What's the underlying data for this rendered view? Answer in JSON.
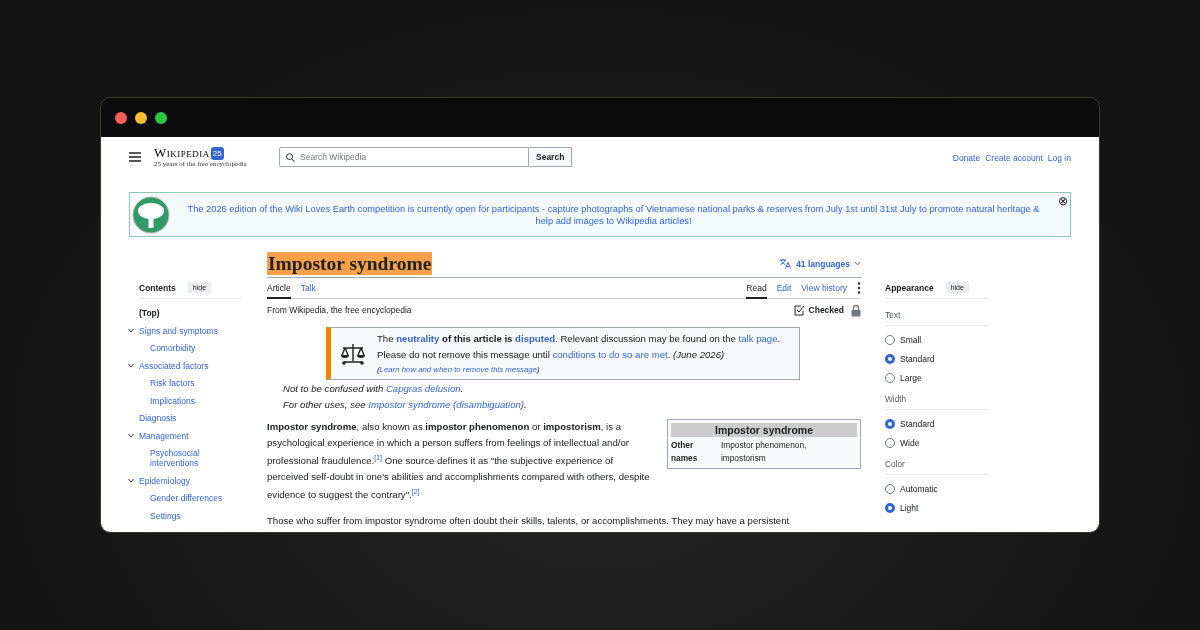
{
  "header": {
    "logo_title": "Wikipedia",
    "logo_badge": "25",
    "logo_tagline": "25 years of the free encyclopedia",
    "search": {
      "placeholder": "Search Wikipedia",
      "button": "Search"
    },
    "links": [
      "Donate",
      "Create account",
      "Log in"
    ]
  },
  "banner": {
    "text": "The 2026 edition of the Wiki Loves Earth competition is currently open for participants - capture photographs of Vietnamese national parks & reserves from July 1st until 31st July to promote natural heritage & help add images to Wikipedia articles!",
    "close": "⊗"
  },
  "toc": {
    "title": "Contents",
    "hide": "hide",
    "items": [
      {
        "label": "(Top)",
        "selected": true
      },
      {
        "label": "Signs and symptoms",
        "selected": false,
        "expanded": true,
        "children": [
          {
            "label": "Comorbidity",
            "selected": false
          }
        ]
      },
      {
        "label": "Associated factors",
        "selected": false,
        "expanded": true,
        "children": [
          {
            "label": "Risk factors",
            "selected": false
          },
          {
            "label": "Implications",
            "selected": false
          }
        ]
      },
      {
        "label": "Diagnosis",
        "selected": false
      },
      {
        "label": "Management",
        "selected": false,
        "expanded": true,
        "children": [
          {
            "label": "Psychosocial interventions",
            "selected": false
          }
        ]
      },
      {
        "label": "Epidemiology",
        "selected": false,
        "expanded": true,
        "children": [
          {
            "label": "Gender differences",
            "selected": false
          },
          {
            "label": "Settings",
            "selected": false
          }
        ]
      }
    ]
  },
  "article": {
    "title": "Impostor syndrome",
    "languages": "41 languages",
    "tabs_left": [
      {
        "label": "Article",
        "selected": true
      },
      {
        "label": "Talk",
        "selected": false
      }
    ],
    "tabs_right": [
      {
        "label": "Read",
        "selected": true
      },
      {
        "label": "Edit",
        "selected": false
      },
      {
        "label": "View history",
        "selected": false
      }
    ],
    "tagline": "From Wikipedia, the free encyclopedia",
    "checked": "Checked",
    "notice": {
      "lines": [
        [
          {
            "kind": "plain",
            "text": "The "
          },
          {
            "kind": "boldlink",
            "text": "neutrality"
          },
          {
            "kind": "bold",
            "text": " of this article is "
          },
          {
            "kind": "boldlink",
            "text": "disputed"
          },
          {
            "kind": "plain",
            "text": ". Relevant discussion may be found on the "
          },
          {
            "kind": "link",
            "text": "talk page"
          },
          {
            "kind": "plain",
            "text": ". Please do not remove this message until "
          },
          {
            "kind": "link",
            "text": "conditions to do so are met"
          },
          {
            "kind": "plain",
            "text": ". "
          },
          {
            "kind": "italic",
            "text": "(June 2026)"
          }
        ],
        [
          {
            "kind": "small",
            "text": "("
          },
          {
            "kind": "smalllink",
            "text": "Learn how and when to remove this message"
          },
          {
            "kind": "small",
            "text": ")"
          }
        ]
      ]
    },
    "hatnotes": [
      [
        {
          "kind": "plain",
          "text": "Not to be confused with "
        },
        {
          "kind": "link",
          "text": "Capgras delusion"
        },
        {
          "kind": "plain",
          "text": "."
        }
      ],
      [
        {
          "kind": "plain",
          "text": "For other uses, see "
        },
        {
          "kind": "link",
          "text": "Impostor syndrome (disambiguation)"
        },
        {
          "kind": "plain",
          "text": "."
        }
      ]
    ],
    "infobox": {
      "title": "Impostor syndrome",
      "rows": [
        {
          "label": "Other names",
          "value": "Impostor phenomenon, impostorism"
        }
      ]
    },
    "paragraphs": [
      [
        {
          "kind": "bold",
          "text": "Impostor syndrome"
        },
        {
          "kind": "plain",
          "text": ", also known as "
        },
        {
          "kind": "bold",
          "text": "impostor phenomenon"
        },
        {
          "kind": "plain",
          "text": " or "
        },
        {
          "kind": "bold",
          "text": "impostorism"
        },
        {
          "kind": "plain",
          "text": ", is a psychological experience in which a person suffers from feelings of intellectual and/or professional fraudulence."
        },
        {
          "kind": "ref",
          "text": "[1]"
        },
        {
          "kind": "plain",
          "text": " One source defines it as \"the subjective experience of perceived self-doubt in one's abilities and accomplishments compared with others, despite evidence to suggest the contrary\"."
        },
        {
          "kind": "ref",
          "text": "[2]"
        }
      ],
      [
        {
          "kind": "plain",
          "text": "Those who suffer from impostor syndrome often doubt their skills, talents, or accomplishments. They may have a persistent"
        }
      ]
    ]
  },
  "appearance": {
    "title": "Appearance",
    "hide": "hide",
    "groups": [
      {
        "label": "Text",
        "options": [
          {
            "label": "Small",
            "selected": false
          },
          {
            "label": "Standard",
            "selected": true
          },
          {
            "label": "Large",
            "selected": false
          }
        ]
      },
      {
        "label": "Width",
        "options": [
          {
            "label": "Standard",
            "selected": true
          },
          {
            "label": "Wide",
            "selected": false
          }
        ]
      },
      {
        "label": "Color",
        "options": [
          {
            "label": "Automatic",
            "selected": false
          },
          {
            "label": "Light",
            "selected": true
          }
        ]
      }
    ]
  }
}
